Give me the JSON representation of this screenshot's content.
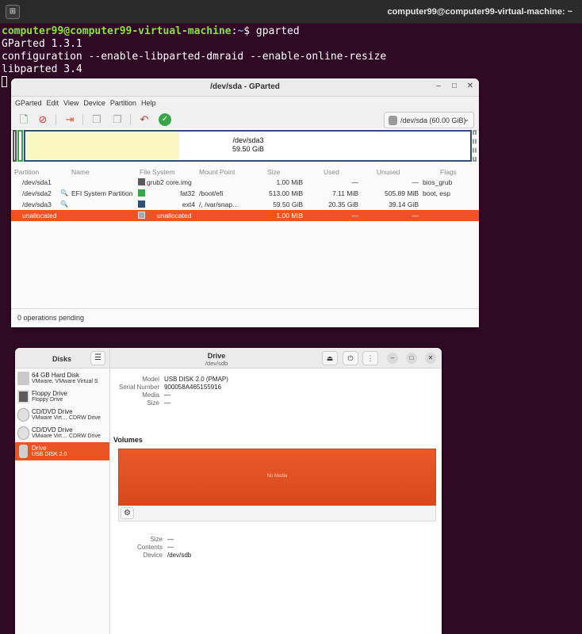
{
  "terminal": {
    "title": "computer99@computer99-virtual-machine: ~",
    "newtab_icon": "new-tab-icon",
    "prompt_user": "computer99@computer99-virtual-machine",
    "prompt_sep": ":",
    "prompt_path": "~",
    "prompt_dollar": "$ ",
    "command": "gparted",
    "output": [
      "GParted 1.3.1",
      "configuration --enable-libparted-dmraid --enable-online-resize",
      "libparted 3.4"
    ]
  },
  "gparted": {
    "title": "/dev/sda - GParted",
    "menu": [
      "GParted",
      "Edit",
      "View",
      "Device",
      "Partition",
      "Help"
    ],
    "device": "/dev/sda (60.00 GiB)",
    "diskmap": {
      "label": "/dev/sda3",
      "size": "59.50 GiB"
    },
    "headers": {
      "partition": "Partition",
      "name": "Name",
      "fs": "File System",
      "mount": "Mount Point",
      "size": "Size",
      "used": "Used",
      "unused": "Unused",
      "flags": "Flags"
    },
    "rows": [
      {
        "partition": "/dev/sda1",
        "name": "",
        "color": "#5b5b5b",
        "fs": "grub2 core.img",
        "mount": "",
        "size": "1.00 MiB",
        "used": "—",
        "unused": "—",
        "flags": "bios_grub"
      },
      {
        "partition": "/dev/sda2",
        "name": "EFI System Partition",
        "color": "#3aa64a",
        "fs": "fat32",
        "mount": "/boot/efi",
        "size": "513.00 MiB",
        "used": "7.11 MiB",
        "unused": "505.89 MiB",
        "flags": "boot, esp"
      },
      {
        "partition": "/dev/sda3",
        "name": "",
        "color": "#2f4f78",
        "fs": "ext4",
        "mount": "/, /var/snap…",
        "size": "59.50 GiB",
        "used": "20.35 GiB",
        "unused": "39.14 GiB",
        "flags": ""
      },
      {
        "partition": "unallocated",
        "name": "",
        "color": "#a8a8a8",
        "fs": "unallocated",
        "mount": "",
        "size": "1.00 MiB",
        "used": "—",
        "unused": "—",
        "flags": ""
      }
    ],
    "status": "0 operations pending"
  },
  "disks": {
    "sidebar_title": "Disks",
    "header_title": "Drive",
    "header_sub": "/dev/sdb",
    "items": [
      {
        "title": "64 GB Hard Disk",
        "sub": "VMware, VMware Virtual S"
      },
      {
        "title": "Floppy Drive",
        "sub": "Floppy Drive"
      },
      {
        "title": "CD/DVD Drive",
        "sub": "VMware Virt…    CDRW Drive"
      },
      {
        "title": "CD/DVD Drive",
        "sub": "VMware Virt…    CDRW Drive"
      },
      {
        "title": "Drive",
        "sub": "USB DISK 2.0"
      }
    ],
    "details": {
      "model_k": "Model",
      "model_v": "USB DISK 2.0 (PMAP)",
      "serial_k": "Serial Number",
      "serial_v": "900058A465155916",
      "media_k": "Media",
      "media_v": "—",
      "size_k": "Size",
      "size_v": "—"
    },
    "volumes_title": "Volumes",
    "volume_label": "No Media",
    "bottom": {
      "size_k": "Size",
      "size_v": "—",
      "contents_k": "Contents",
      "contents_v": "—",
      "device_k": "Device",
      "device_v": "/dev/sdb"
    }
  }
}
